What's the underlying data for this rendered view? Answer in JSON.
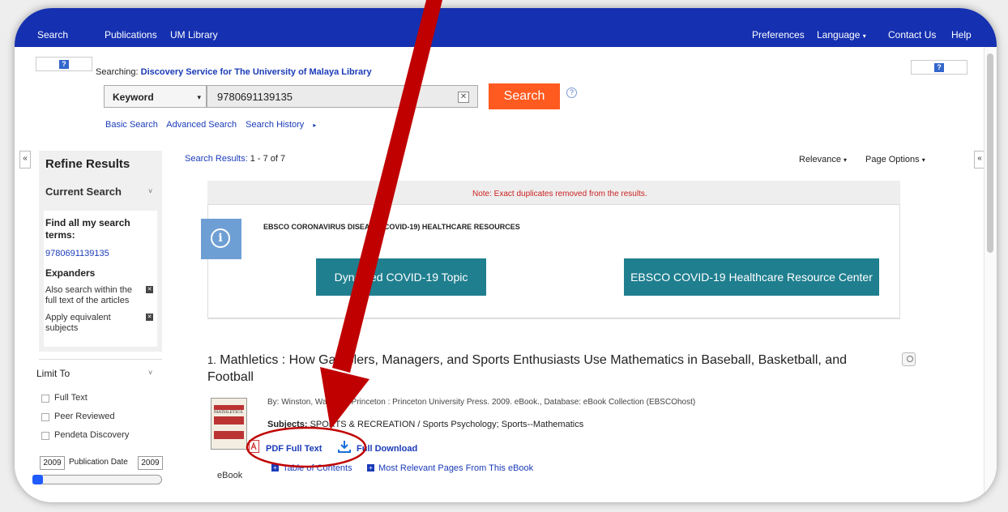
{
  "topnav": {
    "left": [
      "Search",
      "Publications",
      "UM Library"
    ],
    "right": [
      "Preferences",
      "Language",
      "Contact Us",
      "Help"
    ]
  },
  "search": {
    "searching_prefix": "Searching:",
    "searching_target": "Discovery Service for The University of Malaya Library",
    "field_select": "Keyword",
    "query": "9780691139135",
    "button": "Search",
    "links": [
      "Basic Search",
      "Advanced Search",
      "Search History"
    ]
  },
  "sidebar": {
    "title": "Refine Results",
    "current_search": "Current Search",
    "find_all": "Find all my search terms:",
    "term": "9780691139135",
    "expanders_title": "Expanders",
    "expanders": [
      "Also search within the full text of the articles",
      "Apply equivalent subjects"
    ],
    "limit_to": "Limit To",
    "limits": [
      "Full Text",
      "Peer Reviewed",
      "Pendeta Discovery"
    ],
    "date_from": "2009",
    "date_label": "Publication Date",
    "date_to": "2009"
  },
  "results": {
    "count_label": "Search Results:",
    "count_value": "1 - 7 of 7",
    "relevance": "Relevance",
    "page_options": "Page Options",
    "note": "Note: Exact duplicates removed from the results.",
    "covid_header": "EBSCO CORONAVIRUS DISEASE (COVID-19) HEALTHCARE RESOURCES",
    "covid_btn_1": "DynaMed COVID-19 Topic",
    "covid_btn_2": "EBSCO COVID-19 Healthcare Resource Center",
    "item": {
      "number": "1.",
      "title": "Mathletics : How Gamblers, Managers, and Sports Enthusiasts Use Mathematics in Baseball, Basketball, and Football",
      "byline": "By: Winston, Wayne L. Princeton : Princeton University Press. 2009. eBook., Database: eBook Collection (EBSCOhost)",
      "subjects_label": "Subjects:",
      "subjects": "SPORTS & RECREATION / Sports Psychology; Sports--Mathematics",
      "pdf_link": "PDF Full Text",
      "download_link": "Full Download",
      "toc_link": "Table of Contents",
      "mrp_link": "Most Relevant Pages From This eBook",
      "format": "eBook",
      "cover_text": "MATHLETICS"
    }
  },
  "colors": {
    "nav_bg": "#1530b0",
    "search_button": "#ff5a1f",
    "covid_buttons": "#1f7f8f",
    "annotation_red": "#c00000",
    "link": "#1a3bb8"
  }
}
